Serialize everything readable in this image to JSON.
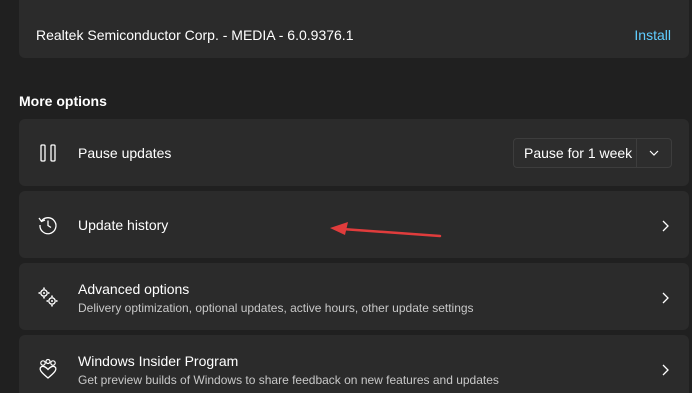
{
  "driver_update": {
    "name": "Realtek Semiconductor Corp. - MEDIA - 6.0.9376.1",
    "action_label": "Install"
  },
  "more_options": {
    "section_title": "More options",
    "pause": {
      "title": "Pause updates",
      "icon": "pause-icon",
      "dropdown_value": "Pause for 1 week"
    },
    "history": {
      "title": "Update history",
      "icon": "history-icon"
    },
    "advanced": {
      "title": "Advanced options",
      "subtitle": "Delivery optimization, optional updates, active hours, other update settings",
      "icon": "gears-icon"
    },
    "insider": {
      "title": "Windows Insider Program",
      "subtitle": "Get preview builds of Windows to share feedback on new features and updates",
      "icon": "insider-icon"
    }
  },
  "colors": {
    "background": "#202020",
    "card": "#2b2b2b",
    "accent_link": "#60cdff",
    "annotation_arrow": "#e03c3c"
  }
}
